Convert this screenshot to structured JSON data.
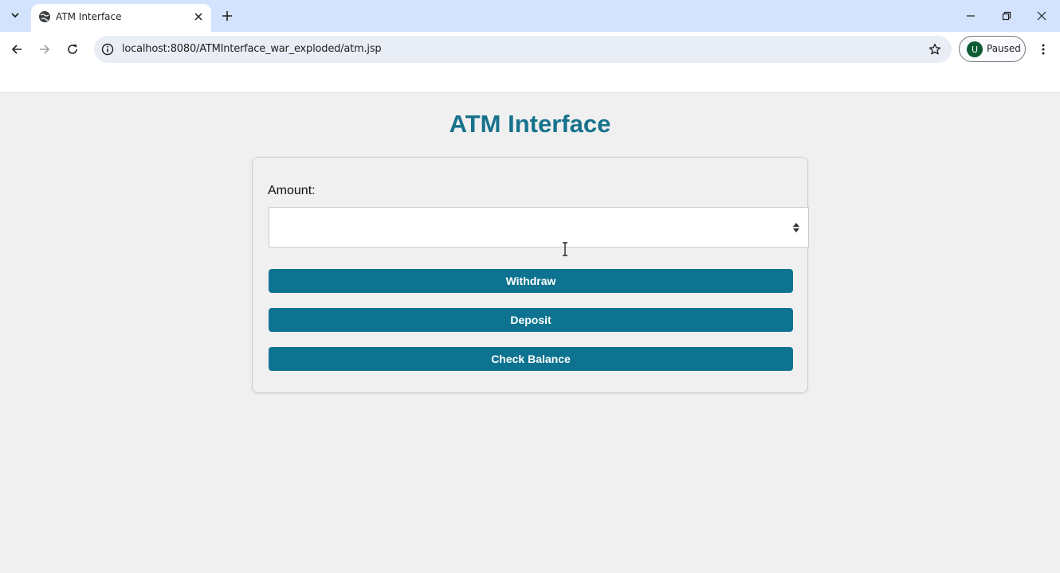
{
  "browser": {
    "tab": {
      "title": "ATM Interface"
    },
    "address_bar": {
      "url": "localhost:8080/ATMInterface_war_exploded/atm.jsp"
    },
    "profile": {
      "initial": "U",
      "status": "Paused"
    }
  },
  "page": {
    "heading": "ATM Interface",
    "form": {
      "amount_label": "Amount:",
      "amount_value": "",
      "buttons": {
        "withdraw": "Withdraw",
        "deposit": "Deposit",
        "check_balance": "Check Balance"
      }
    }
  },
  "colors": {
    "accent": "#0d7390",
    "heading": "#17728c",
    "tabstrip": "#d3e3fd",
    "page_background": "#f0f0f0"
  }
}
